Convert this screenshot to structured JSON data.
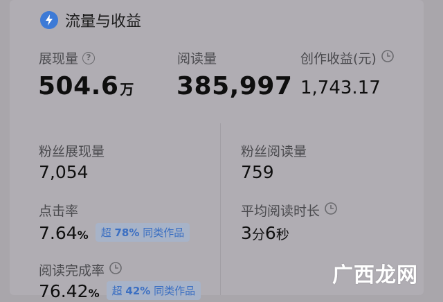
{
  "header": {
    "title": "流量与收益",
    "icon": "lightning-icon"
  },
  "stats_top": {
    "impressions": {
      "label": "展现量",
      "value": "504.6",
      "unit": "万"
    },
    "reads": {
      "label": "阅读量",
      "value": "385,997"
    },
    "earnings": {
      "label": "创作收益(元)",
      "value": "1,743.17"
    }
  },
  "stats": {
    "fan_impressions": {
      "label": "粉丝展现量",
      "value": "7,054"
    },
    "fan_reads": {
      "label": "粉丝阅读量",
      "value": "759"
    },
    "ctr": {
      "label": "点击率",
      "value": "7.64",
      "unit": "%",
      "compare_prefix": "超",
      "compare_value": "78%",
      "compare_suffix": "同类作品"
    },
    "avg_read_time": {
      "label": "平均阅读时长",
      "min_value": "3",
      "min_unit": "分",
      "sec_value": "6",
      "sec_unit": "秒"
    },
    "completion": {
      "label": "阅读完成率",
      "value": "76.42",
      "unit": "%",
      "compare_prefix": "超",
      "compare_value": "42%",
      "compare_suffix": "同类作品"
    }
  },
  "watermark": "广西龙网",
  "colors": {
    "accent": "#3d7ad6",
    "chip_text": "#3b6fc2"
  }
}
